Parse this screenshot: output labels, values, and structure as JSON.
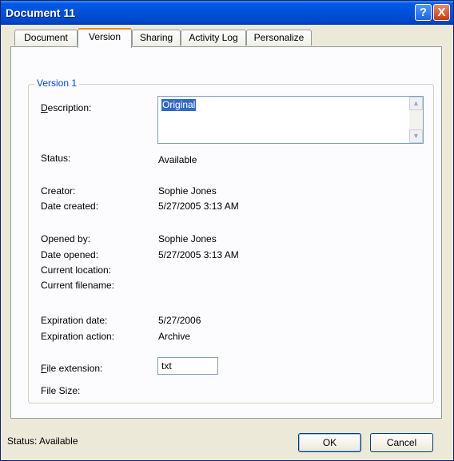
{
  "window": {
    "title": "Document 11"
  },
  "titlebar": {
    "help_glyph": "?",
    "close_glyph": "X",
    "icons": [
      "help-icon",
      "close-icon"
    ]
  },
  "tabs": [
    {
      "label": "Document",
      "active": false
    },
    {
      "label": "Version",
      "active": true
    },
    {
      "label": "Sharing",
      "active": false
    },
    {
      "label": "Activity Log",
      "active": false
    },
    {
      "label": "Personalize",
      "active": false
    }
  ],
  "version_group": {
    "legend": "Version 1"
  },
  "fields": {
    "description": {
      "label_accel": "D",
      "label_rest": "escription:",
      "value": "Original"
    },
    "status": {
      "label": "Status:",
      "value": "Available"
    },
    "creator": {
      "label": "Creator:",
      "value": "Sophie Jones"
    },
    "date_created": {
      "label": "Date created:",
      "value": "5/27/2005 3:13 AM"
    },
    "opened_by": {
      "label": "Opened by:",
      "value": "Sophie Jones"
    },
    "date_opened": {
      "label": "Date opened:",
      "value": "5/27/2005 3:13 AM"
    },
    "current_location": {
      "label": "Current location:",
      "value": ""
    },
    "current_filename": {
      "label": "Current filename:",
      "value": ""
    },
    "expiration_date": {
      "label": "Expiration date:",
      "value": "5/27/2006"
    },
    "expiration_action": {
      "label": "Expiration action:",
      "value": "Archive"
    },
    "file_extension": {
      "label_accel": "F",
      "label_rest": "ile extension:",
      "value": "txt"
    },
    "file_size": {
      "label": "File Size:",
      "value": ""
    }
  },
  "statusbar": {
    "text": "Status: Available"
  },
  "buttons": {
    "ok": "OK",
    "cancel": "Cancel"
  },
  "colors": {
    "titlebar": "#0058e6",
    "legend": "#0046d5",
    "selection": "#316ac5",
    "active_tab_accent": "#e68b2c"
  }
}
